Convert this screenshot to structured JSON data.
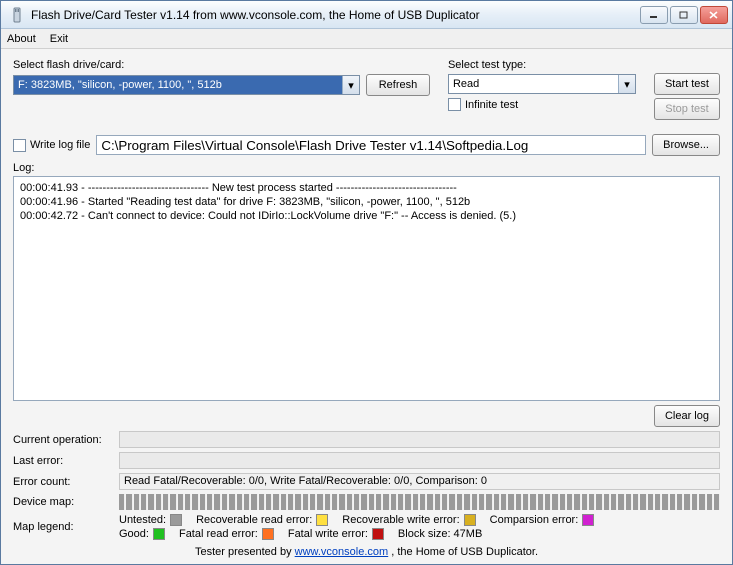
{
  "titlebar": {
    "text": "Flash Drive/Card Tester v1.14 from www.vconsole.com, the Home of USB Duplicator"
  },
  "menu": {
    "about": "About",
    "exit": "Exit"
  },
  "select_drive": {
    "label": "Select flash drive/card:",
    "value": "F: 3823MB, \"silicon, -power, 1100, \", 512b",
    "refresh": "Refresh"
  },
  "select_test": {
    "label": "Select test type:",
    "value": "Read",
    "infinite_label": "Infinite test"
  },
  "buttons": {
    "start": "Start test",
    "stop": "Stop test",
    "browse": "Browse...",
    "clearlog": "Clear log"
  },
  "logfile": {
    "checkbox_label": "Write log file",
    "path": "C:\\Program Files\\Virtual Console\\Flash Drive Tester v1.14\\Softpedia.Log"
  },
  "log": {
    "label": "Log:",
    "lines": "00:00:41.93 - --------------------------------- New test process started ---------------------------------\n00:00:41.96 - Started \"Reading test data\" for drive F: 3823MB, \"silicon, -power, 1100, \", 512b\n00:00:42.72 - Can't connect to device: Could not IDirIo::LockVolume drive \"F:\" -- Access is denied. (5.)"
  },
  "status": {
    "current_op_label": "Current operation:",
    "current_op_value": "",
    "last_error_label": "Last error:",
    "last_error_value": "",
    "error_count_label": "Error count:",
    "error_count_value": "Read Fatal/Recoverable: 0/0, Write Fatal/Recoverable: 0/0, Comparison: 0",
    "device_map_label": "Device map:",
    "map_legend_label": "Map legend:"
  },
  "legend": {
    "untested": "Untested:",
    "rec_read": "Recoverable read error:",
    "rec_write": "Recoverable write error:",
    "comparison": "Comparsion error:",
    "good": "Good:",
    "fatal_read": "Fatal read error:",
    "fatal_write": "Fatal write error:",
    "block_size": "Block size: 47MB"
  },
  "colors": {
    "untested": "#9a9a9a",
    "rec_read": "#ffe040",
    "rec_write": "#d8b020",
    "comparison": "#d020d0",
    "good": "#20c020",
    "fatal_read": "#ff7020",
    "fatal_write": "#c01010"
  },
  "footer": {
    "prefix": "Tester presented by ",
    "link": "www.vconsole.com",
    "suffix": " , the Home of USB Duplicator."
  }
}
